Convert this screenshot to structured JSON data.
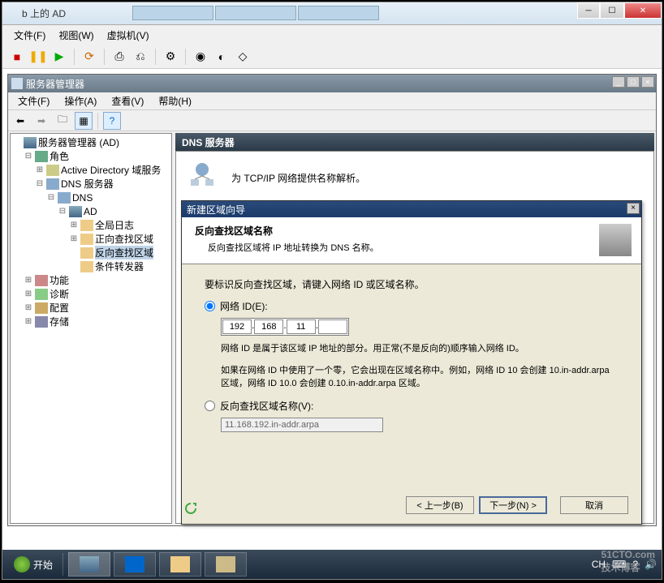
{
  "outerWindow": {
    "title": "b 上的 AD",
    "menu": {
      "file": "文件(F)",
      "view": "视图(W)",
      "vm": "虚拟机(V)"
    }
  },
  "innerWindow": {
    "title": "服务器管理器",
    "menu": {
      "file": "文件(F)",
      "action": "操作(A)",
      "view": "查看(V)",
      "help": "帮助(H)"
    }
  },
  "tree": {
    "root": "服务器管理器 (AD)",
    "roles": "角色",
    "ad": "Active Directory 域服务",
    "dnsServer": "DNS 服务器",
    "dns": "DNS",
    "adNode": "AD",
    "globalLog": "全局日志",
    "forwardZone": "正向查找区域",
    "reverseZone": "反向查找区域",
    "condForward": "条件转发器",
    "features": "功能",
    "diagnostics": "诊断",
    "config": "配置",
    "storage": "存储"
  },
  "content": {
    "header": "DNS 服务器",
    "intro": "为 TCP/IP 网络提供名称解析。"
  },
  "wizard": {
    "title": "新建区域向导",
    "headerTitle": "反向查找区域名称",
    "headerSub": "反向查找区域将 IP 地址转换为 DNS 名称。",
    "prompt": "要标识反向查找区域，请键入网络 ID 或区域名称。",
    "radioNetworkId": "网络 ID(E):",
    "ip": {
      "o1": "192",
      "o2": "168",
      "o3": "11",
      "o4": ""
    },
    "note1": "网络 ID 是属于该区域 IP 地址的部分。用正常(不是反向的)顺序输入网络 ID。",
    "note2": "如果在网络 ID 中使用了一个零，它会出现在区域名称中。例如，网络 ID 10 会创建 10.in-addr.arpa 区域，网络 ID 10.0 会创建 0.10.in-addr.arpa 区域。",
    "radioZoneName": "反向查找区域名称(V):",
    "zoneNameValue": "11.168.192.in-addr.arpa",
    "btnBack": "< 上一步(B)",
    "btnNext": "下一步(N) >",
    "btnCancel": "取消"
  },
  "taskbar": {
    "start": "开始",
    "lang": "CH"
  },
  "watermark": {
    "line1": "51CTO.com",
    "line2": "技术博客"
  }
}
